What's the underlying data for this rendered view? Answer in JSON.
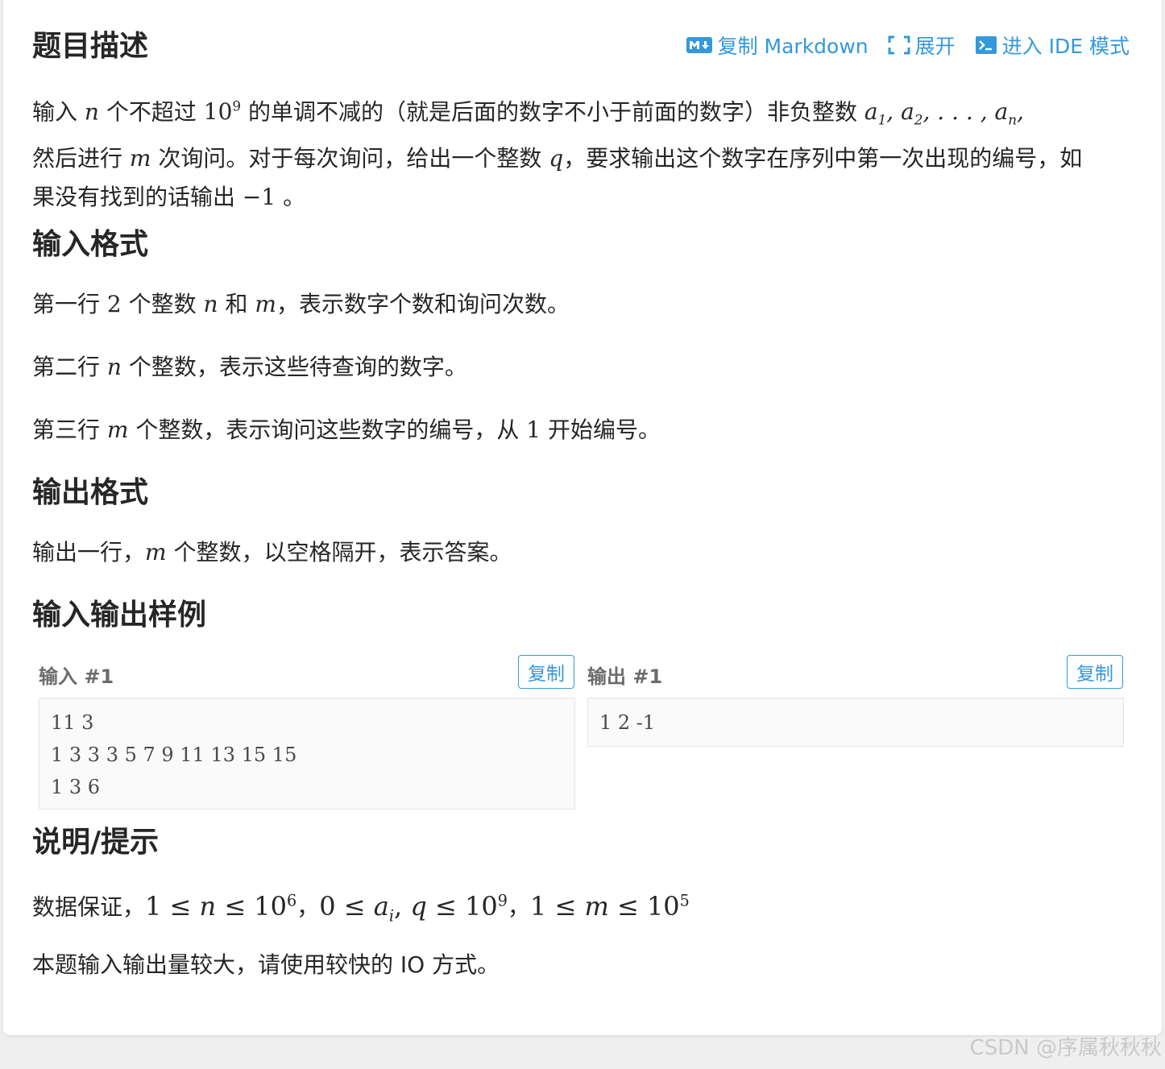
{
  "toolbar": {
    "copy_markdown_label": "复制 Markdown",
    "expand_label": "展开",
    "ide_label": "进入 IDE 模式"
  },
  "sections": {
    "description_title": "题目描述",
    "input_format_title": "输入格式",
    "output_format_title": "输出格式",
    "samples_title": "输入输出样例",
    "hint_title": "说明/提示"
  },
  "description": {
    "t1": "输入 ",
    "t2": " 个不超过 ",
    "t3": " 的单调不减的（就是后面的数字不小于前面的数字）非负整数 ",
    "t4": "然后进行 ",
    "t5": " 次询问。对于每次询问，给出一个整数 ",
    "t6": "，要求输出这个数字在序列中第一次出现的编号，如果没有找到的话输出 ",
    "t7": " 。"
  },
  "input_format": {
    "line1_a": "第一行 ",
    "line1_b": " 个整数 ",
    "line1_c": " 和 ",
    "line1_d": "，表示数字个数和询问次数。",
    "line2_a": "第二行 ",
    "line2_b": " 个整数，表示这些待查询的数字。",
    "line3_a": "第三行 ",
    "line3_b": " 个整数，表示询问这些数字的编号，从 ",
    "line3_c": " 开始编号。"
  },
  "output_format": {
    "a": "输出一行，",
    "b": " 个整数，以空格隔开，表示答案。"
  },
  "samples": {
    "input_label": "输入 #1",
    "output_label": "输出 #1",
    "copy_label": "复制",
    "input_lines": [
      "11 3",
      "1 3 3 3 5 7 9 11 13 15 15",
      "1 3 6"
    ],
    "output_lines": [
      "1 2 -1"
    ]
  },
  "hint": {
    "a": "数据保证，",
    "b": "本题输入输出量较大，请使用较快的 IO 方式。"
  },
  "watermark": "CSDN @序属秋秋秋",
  "colors": {
    "accent": "#3498db",
    "background": "#efefef",
    "card": "#ffffff"
  }
}
